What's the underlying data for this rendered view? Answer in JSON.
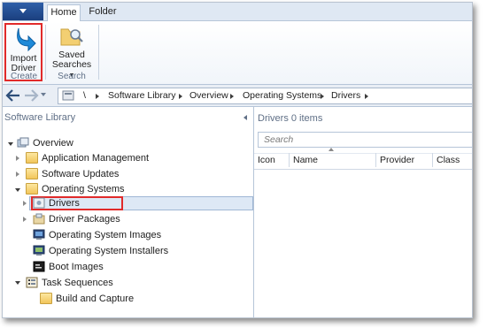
{
  "tabs": {
    "home": "Home",
    "folder": "Folder"
  },
  "ribbon": {
    "import_line1": "Import",
    "import_line2": "Driver",
    "saved_line1": "Saved",
    "saved_line2": "Searches",
    "group_create": "Create",
    "group_search": "Search"
  },
  "nav": {
    "breadcrumb": [
      "\\",
      "Software Library",
      "Overview",
      "Operating Systems",
      "Drivers"
    ]
  },
  "left_pane": {
    "header": "Software Library",
    "tree": {
      "overview": "Overview",
      "application_management": "Application Management",
      "software_updates": "Software Updates",
      "operating_systems": "Operating Systems",
      "drivers": "Drivers",
      "driver_packages": "Driver Packages",
      "os_images": "Operating System Images",
      "os_installers": "Operating System Installers",
      "boot_images": "Boot Images",
      "task_sequences": "Task Sequences",
      "build_and_capture": "Build and Capture"
    }
  },
  "right_pane": {
    "title": "Drivers 0 items",
    "search_placeholder": "Search",
    "columns": [
      "Icon",
      "Name",
      "Provider",
      "Class"
    ]
  },
  "colors": {
    "accent": "#1b3f7e",
    "highlight_red": "#e12a2a",
    "selection": "#dde8f5"
  }
}
